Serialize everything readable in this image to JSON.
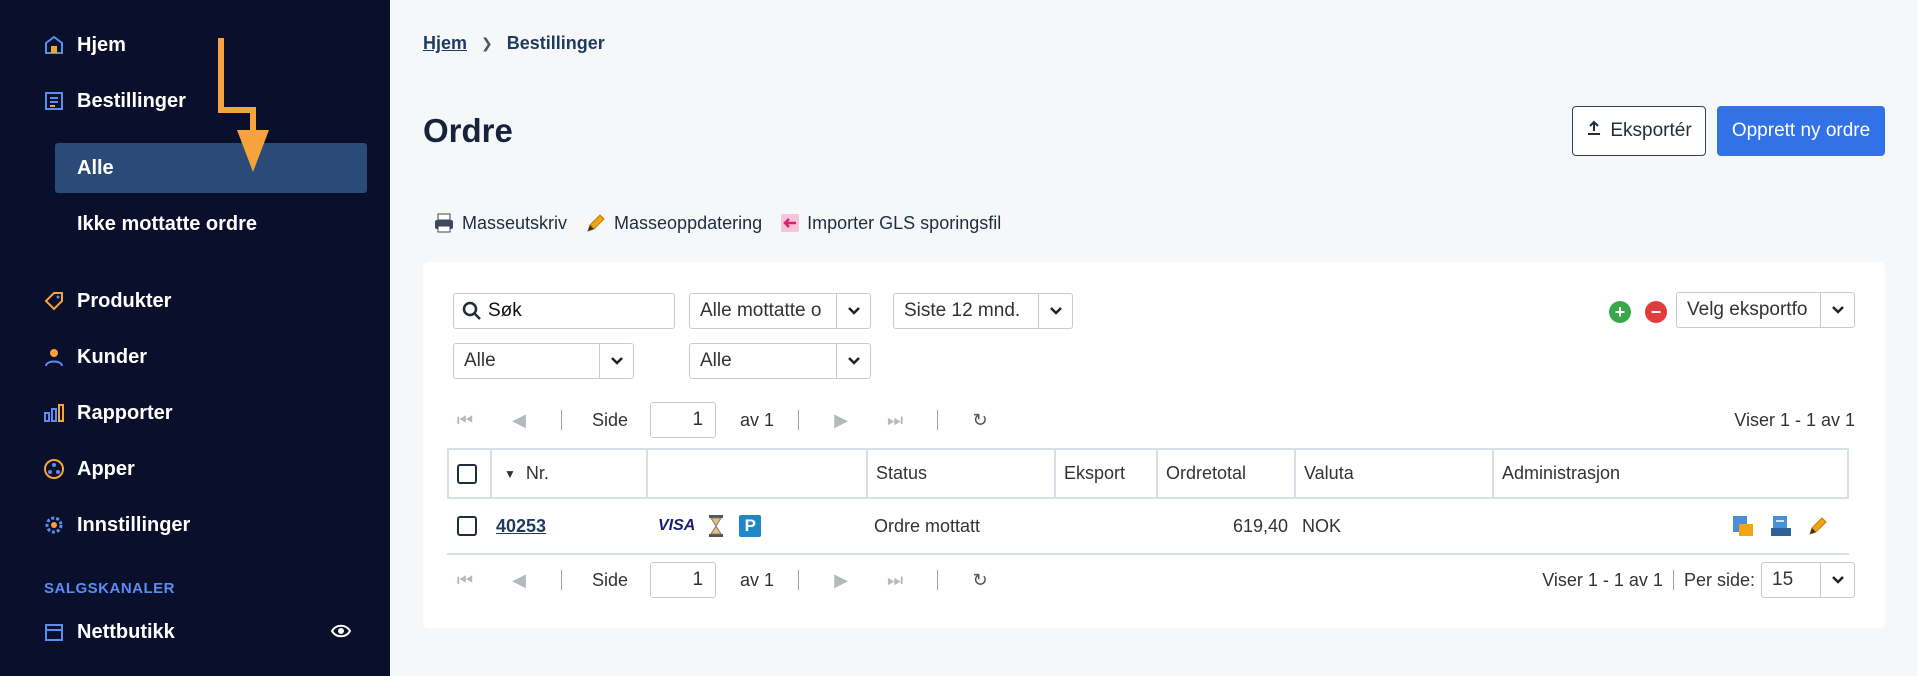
{
  "sidebar": {
    "items": [
      {
        "label": "Hjem",
        "icon": "home-icon"
      },
      {
        "label": "Bestillinger",
        "icon": "orders-icon"
      },
      {
        "label": "Produkter",
        "icon": "tag-icon"
      },
      {
        "label": "Kunder",
        "icon": "user-icon"
      },
      {
        "label": "Rapporter",
        "icon": "bar-chart-icon"
      },
      {
        "label": "Apper",
        "icon": "apps-icon"
      },
      {
        "label": "Innstillinger",
        "icon": "gear-icon"
      }
    ],
    "sub_items": [
      {
        "label": "Alle",
        "active": true
      },
      {
        "label": "Ikke mottatte ordre",
        "active": false
      }
    ],
    "section_label": "SALGSKANALER",
    "channel": {
      "label": "Nettbutikk",
      "icon": "store-icon"
    }
  },
  "breadcrumb": {
    "home": "Hjem",
    "current": "Bestillinger"
  },
  "page": {
    "title": "Ordre"
  },
  "buttons": {
    "export": "Eksportér",
    "new_order": "Opprett ny ordre"
  },
  "actions": [
    {
      "label": "Masseutskriv",
      "icon": "printer-icon"
    },
    {
      "label": "Masseoppdatering",
      "icon": "pencil-icon"
    },
    {
      "label": "Importer GLS sporingsfil",
      "icon": "import-icon"
    }
  ],
  "filters": {
    "search_value": "Søk",
    "status": "Alle mottatte o",
    "period": "Siste 12 mnd.",
    "filter3": "Alle",
    "filter4": "Alle",
    "export_format": "Velg eksportfo"
  },
  "pager_top": {
    "page_label": "Side",
    "page": "1",
    "of": "av 1",
    "showing": "Viser 1 - 1 av 1"
  },
  "pager_bottom": {
    "page_label": "Side",
    "page": "1",
    "of": "av 1",
    "showing": "Viser 1 - 1 av 1",
    "per_page_label": "Per side:",
    "per_page": "15"
  },
  "table": {
    "headers": {
      "nr": "Nr.",
      "status": "Status",
      "eksport": "Eksport",
      "ordretotal": "Ordretotal",
      "valuta": "Valuta",
      "admin": "Administrasjon"
    },
    "rows": [
      {
        "nr": "40253",
        "payment": "VISA",
        "shipping": "P",
        "status": "Ordre mottatt",
        "total": "619,40",
        "currency": "NOK"
      }
    ]
  },
  "colors": {
    "sidebar_bg": "#0a0f2b",
    "active_bg": "#2a4a78",
    "primary": "#3272e6",
    "accent_arrow": "#f7a23b",
    "section": "#5b8def"
  }
}
